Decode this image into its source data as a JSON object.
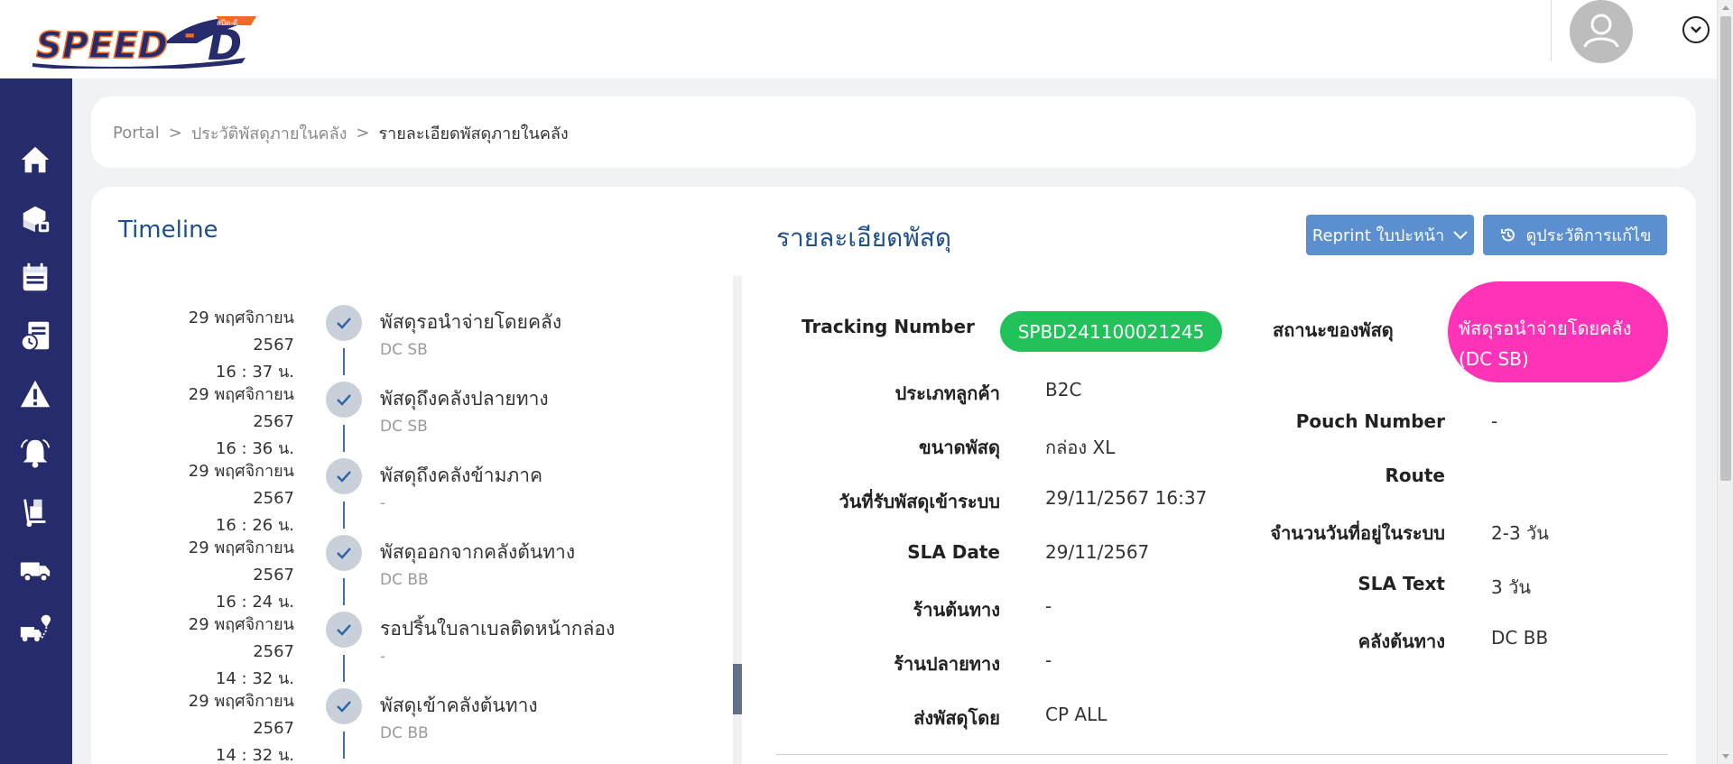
{
  "app": {
    "logo_text": "SPEED-D",
    "logo_small_text": "สปีด-ดี",
    "brand_colors": {
      "navy": "#262c6b",
      "orange": "#ef6a24",
      "blue": "#1d4f8c"
    }
  },
  "sidebar": {
    "items": [
      {
        "icon": "home-icon"
      },
      {
        "icon": "parcel-boxes-icon"
      },
      {
        "icon": "warehouse-calendar-icon"
      },
      {
        "icon": "report-clock-icon"
      },
      {
        "icon": "warning-icon"
      },
      {
        "icon": "bell-icon"
      },
      {
        "icon": "hand-truck-icon"
      },
      {
        "icon": "delivery-truck-icon"
      },
      {
        "icon": "route-truck-icon"
      }
    ]
  },
  "breadcrumb": {
    "items": [
      "Portal",
      "ประวัติพัสดุภายในคลัง",
      "รายละเอียดพัสดุภายในคลัง"
    ],
    "separator": ">"
  },
  "timeline": {
    "title": "Timeline",
    "items": [
      {
        "date_line1": "29 พฤศจิกายน",
        "date_line2": "2567",
        "time": "16 : 37 น.",
        "status": "พัสดุรอนำจ่ายโดยคลัง",
        "location": "DC SB"
      },
      {
        "date_line1": "29 พฤศจิกายน",
        "date_line2": "2567",
        "time": "16 : 36 น.",
        "status": "พัสดุถึงคลังปลายทาง",
        "location": "DC SB"
      },
      {
        "date_line1": "29 พฤศจิกายน",
        "date_line2": "2567",
        "time": "16 : 26 น.",
        "status": "พัสดุถึงคลังข้ามภาค",
        "location": "-"
      },
      {
        "date_line1": "29 พฤศจิกายน",
        "date_line2": "2567",
        "time": "16 : 24 น.",
        "status": "พัสดุออกจากคลังต้นทาง",
        "location": "DC BB"
      },
      {
        "date_line1": "29 พฤศจิกายน",
        "date_line2": "2567",
        "time": "14 : 32 น.",
        "status": "รอปริ้นใบลาเบลติดหน้ากล่อง",
        "location": "-"
      },
      {
        "date_line1": "29 พฤศจิกายน",
        "date_line2": "2567",
        "time": "14 : 32 น.",
        "status": "พัสดุเข้าคลังต้นทาง",
        "location": "DC BB"
      }
    ]
  },
  "details": {
    "title": "รายละเอียดพัสดุ",
    "reprint_label": "Reprint ใบปะหน้า",
    "history_label": "ดูประวัติการแก้ไข",
    "tracking_label": "Tracking Number",
    "tracking_value": "SPBD241100021245",
    "customer_type_label": "ประเภทลูกค้า",
    "customer_type_value": "B2C",
    "size_label": "ขนาดพัสดุ",
    "size_value": "กล่อง XL",
    "received_label": "วันที่รับพัสดุเข้าระบบ",
    "received_value": "29/11/2567 16:37",
    "sla_date_label": "SLA Date",
    "sla_date_value": "29/11/2567",
    "origin_shop_label": "ร้านต้นทาง",
    "origin_shop_value": "-",
    "dest_shop_label": "ร้านปลายทาง",
    "dest_shop_value": "-",
    "sender_label": "ส่งพัสดุโดย",
    "sender_value": "CP ALL",
    "status_label": "สถานะของพัสดุ",
    "status_value_line1": "พัสดุรอนำจ่ายโดยคลัง",
    "status_value_line2": "(DC SB)",
    "pouch_label": "Pouch Number",
    "pouch_value": "-",
    "route_label": "Route",
    "route_value": "",
    "days_label": "จำนวนวันที่อยู่ในระบบ",
    "days_value": "2-3 วัน",
    "sla_text_label": "SLA Text",
    "sla_text_value": "3 วัน",
    "origin_wh_label": "คลังต้นทาง",
    "origin_wh_value": "DC BB",
    "status_colors": {
      "tracking_pill": "#22c25a",
      "status_pill": "#ff33b8"
    }
  }
}
